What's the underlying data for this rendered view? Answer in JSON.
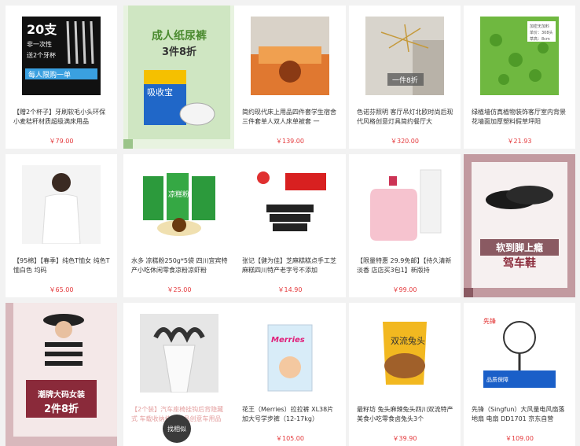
{
  "products": [
    {
      "title": "【赠2个杯子】牙刷软毛小头环保小麦秸秆材质超级满床用品",
      "price": "￥79.00",
      "promo": "20支 非一次性 送2个牙杯 每人限购一单"
    },
    {
      "title": "",
      "price": "",
      "promo_title": "成人纸尿裤",
      "promo_sub": "3件8折",
      "brand": "吸收宝"
    },
    {
      "title": "简约现代床上用品四件套学生宿舍三件套单人双人床单被套 一",
      "price": "￥139.00"
    },
    {
      "title": "色诺芬照明 客厅吊灯北欧时尚后现代风格创意灯具简约餐厅大",
      "price": "￥320.00",
      "badge": "一件8折"
    },
    {
      "title": "绿植墙仿真植物装饰客厅室内背景花墙面加厚塑料假草坪阳",
      "price": "￥21.93",
      "note": "加密无加料 单价：308头 草高：8cm"
    },
    {
      "title": "【95棉】【春季】纯色T恤女 纯色T恤白色 均码",
      "price": "￥65.00"
    },
    {
      "title": "水多 凉糕粉250g*5袋 四川宜宾特产小吃休闲零食凉粉凉虾粉",
      "price": "￥25.00",
      "label": "凉糕粉"
    },
    {
      "title": "张记【健为佳】芝麻糕糕点手工芝麻糕四川特产老字号不添加",
      "price": "￥14.90"
    },
    {
      "title": "【限量特惠 29.9免邮】【持久清新淡香 店店买3包1】新版持",
      "price": "￥99.00"
    },
    {
      "title": "",
      "price": "",
      "promo_title": "软到脚上瘾",
      "promo_sub": "驾车鞋"
    },
    {
      "title": "",
      "price": "",
      "promo_title": "潮牌大码女装",
      "promo_sub": "2件8折"
    },
    {
      "title": "【2个装】汽车座椅挂钩后背隐藏式 车载收纳挂钩用品创意车用品",
      "price": ""
    },
    {
      "title": "花王（Merries）拉拉裤 XL38片 加大号学步裤（12-17kg）",
      "price": "￥105.00",
      "label": "Merries"
    },
    {
      "title": "最籽坊 兔头麻辣兔头四川双流特产美食小吃零食卤兔头3个",
      "price": "￥39.90",
      "label": "双流兔头"
    },
    {
      "title": "先锋（Singfun）大风量电风扇落地扇 电扇 DD1701 京东自营",
      "price": "￥109.00",
      "label": "先锋",
      "note": "品质保障"
    }
  ],
  "locate_button": "找相似"
}
